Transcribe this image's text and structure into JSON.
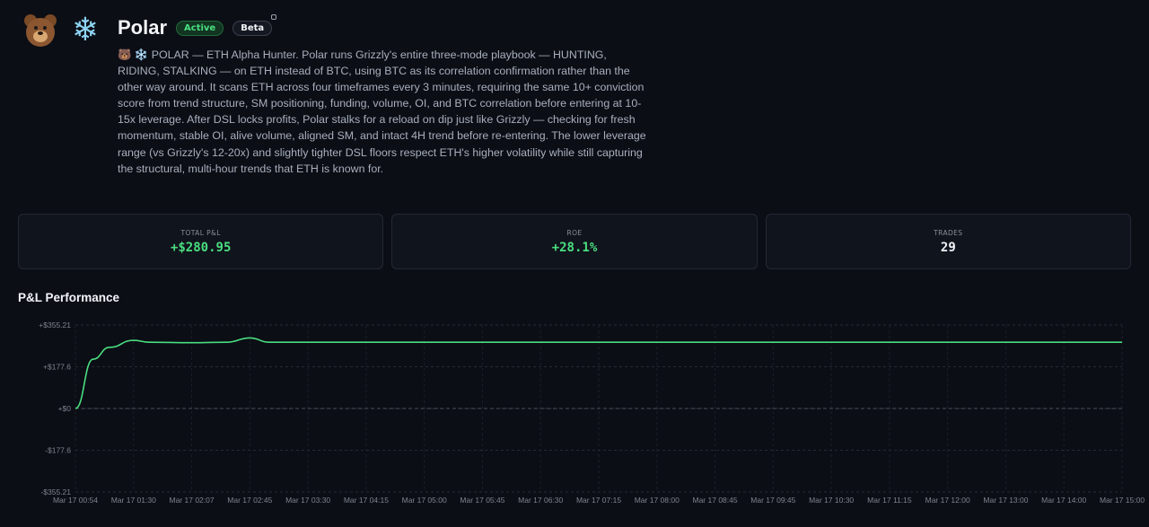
{
  "agent": {
    "name": "Polar",
    "status": "Active",
    "tag": "Beta",
    "icons": [
      "bear-icon",
      "snowflake-icon"
    ],
    "description": "🐻 ❄️ POLAR — ETH Alpha Hunter. Polar runs Grizzly's entire three-mode playbook — HUNTING, RIDING, STALKING — on ETH instead of BTC, using BTC as its correlation confirmation rather than the other way around. It scans ETH across four timeframes every 3 minutes, requiring the same 10+ conviction score from trend structure, SM positioning, funding, volume, OI, and BTC correlation before entering at 10-15x leverage. After DSL locks profits, Polar stalks for a reload on dip just like Grizzly — checking for fresh momentum, stable OI, alive volume, aligned SM, and intact 4H trend before re-entering. The lower leverage range (vs Grizzly's 12-20x) and slightly tighter DSL floors respect ETH's higher volatility while still capturing the structural, multi-hour trends that ETH is known for."
  },
  "stats": {
    "total_pnl_label": "TOTAL P&L",
    "total_pnl_value": "+$280.95",
    "roe_label": "ROE",
    "roe_value": "+28.1%",
    "trades_label": "TRADES",
    "trades_value": "29"
  },
  "colors": {
    "accent_green": "#4ade80",
    "background": "#0b0e15"
  },
  "chart_title": "P&L Performance",
  "chart_data": {
    "type": "line",
    "title": "P&L Performance",
    "ylim": [
      -355.21,
      355.21
    ],
    "y_ticks": [
      "+$355.21",
      "+$177.6",
      "+$0",
      "-$177.6",
      "-$355.21"
    ],
    "x_ticks": [
      "Mar 17 00:54",
      "Mar 17 01:30",
      "Mar 17 02:07",
      "Mar 17 02:45",
      "Mar 17 03:30",
      "Mar 17 04:15",
      "Mar 17 05:00",
      "Mar 17 05:45",
      "Mar 17 06:30",
      "Mar 17 07:15",
      "Mar 17 08:00",
      "Mar 17 08:45",
      "Mar 17 09:45",
      "Mar 17 10:30",
      "Mar 17 11:15",
      "Mar 17 12:00",
      "Mar 17 13:00",
      "Mar 17 14:00",
      "Mar 17 15:00"
    ],
    "grid": true,
    "series": [
      {
        "color": "#4ade80",
        "x": [
          "Mar 17 00:54",
          "Mar 17 01:05",
          "Mar 17 01:15",
          "Mar 17 01:30",
          "Mar 17 01:40",
          "Mar 17 02:07",
          "Mar 17 02:30",
          "Mar 17 02:45",
          "Mar 17 03:00",
          "Mar 17 03:30",
          "Mar 17 06:30",
          "Mar 17 10:30",
          "Mar 17 15:00"
        ],
        "values": [
          0,
          210,
          260,
          290,
          282,
          280,
          282,
          300,
          282,
          282,
          282,
          282,
          282
        ]
      }
    ]
  }
}
